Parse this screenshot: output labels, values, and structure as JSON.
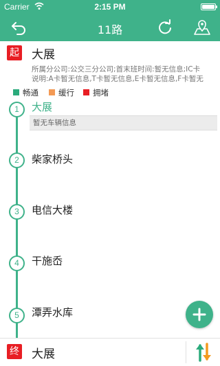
{
  "status_bar": {
    "carrier": "Carrier",
    "time": "2:15 PM"
  },
  "nav": {
    "title": "11路"
  },
  "start": {
    "badge": "起",
    "name": "大展",
    "info_line1": "所属分公司:公交三分公司;首末班时间:暂无信息;IC卡",
    "info_line2": "说明:A卡暂无信息,T卡暂无信息,E卡暂无信息,F卡暂无"
  },
  "legend": [
    {
      "label": "畅通",
      "color": "#2bab7c"
    },
    {
      "label": "缓行",
      "color": "#f39a55"
    },
    {
      "label": "拥堵",
      "color": "#e81e24"
    }
  ],
  "stops": [
    {
      "number": "1",
      "name": "大展",
      "note": "暂无车辆信息"
    },
    {
      "number": "2",
      "name": "柴家桥头"
    },
    {
      "number": "3",
      "name": "电信大楼"
    },
    {
      "number": "4",
      "name": "干施岙"
    },
    {
      "number": "5",
      "name": "潭弄水库"
    }
  ],
  "end": {
    "badge": "终",
    "name": "大展"
  },
  "icons": {
    "back": "back-arrow-icon",
    "refresh": "refresh-icon",
    "map": "map-location-icon",
    "add": "plus-icon",
    "swap": "swap-direction-icon"
  },
  "colors": {
    "accent": "#3fb28a",
    "badge_red": "#e81e24"
  }
}
